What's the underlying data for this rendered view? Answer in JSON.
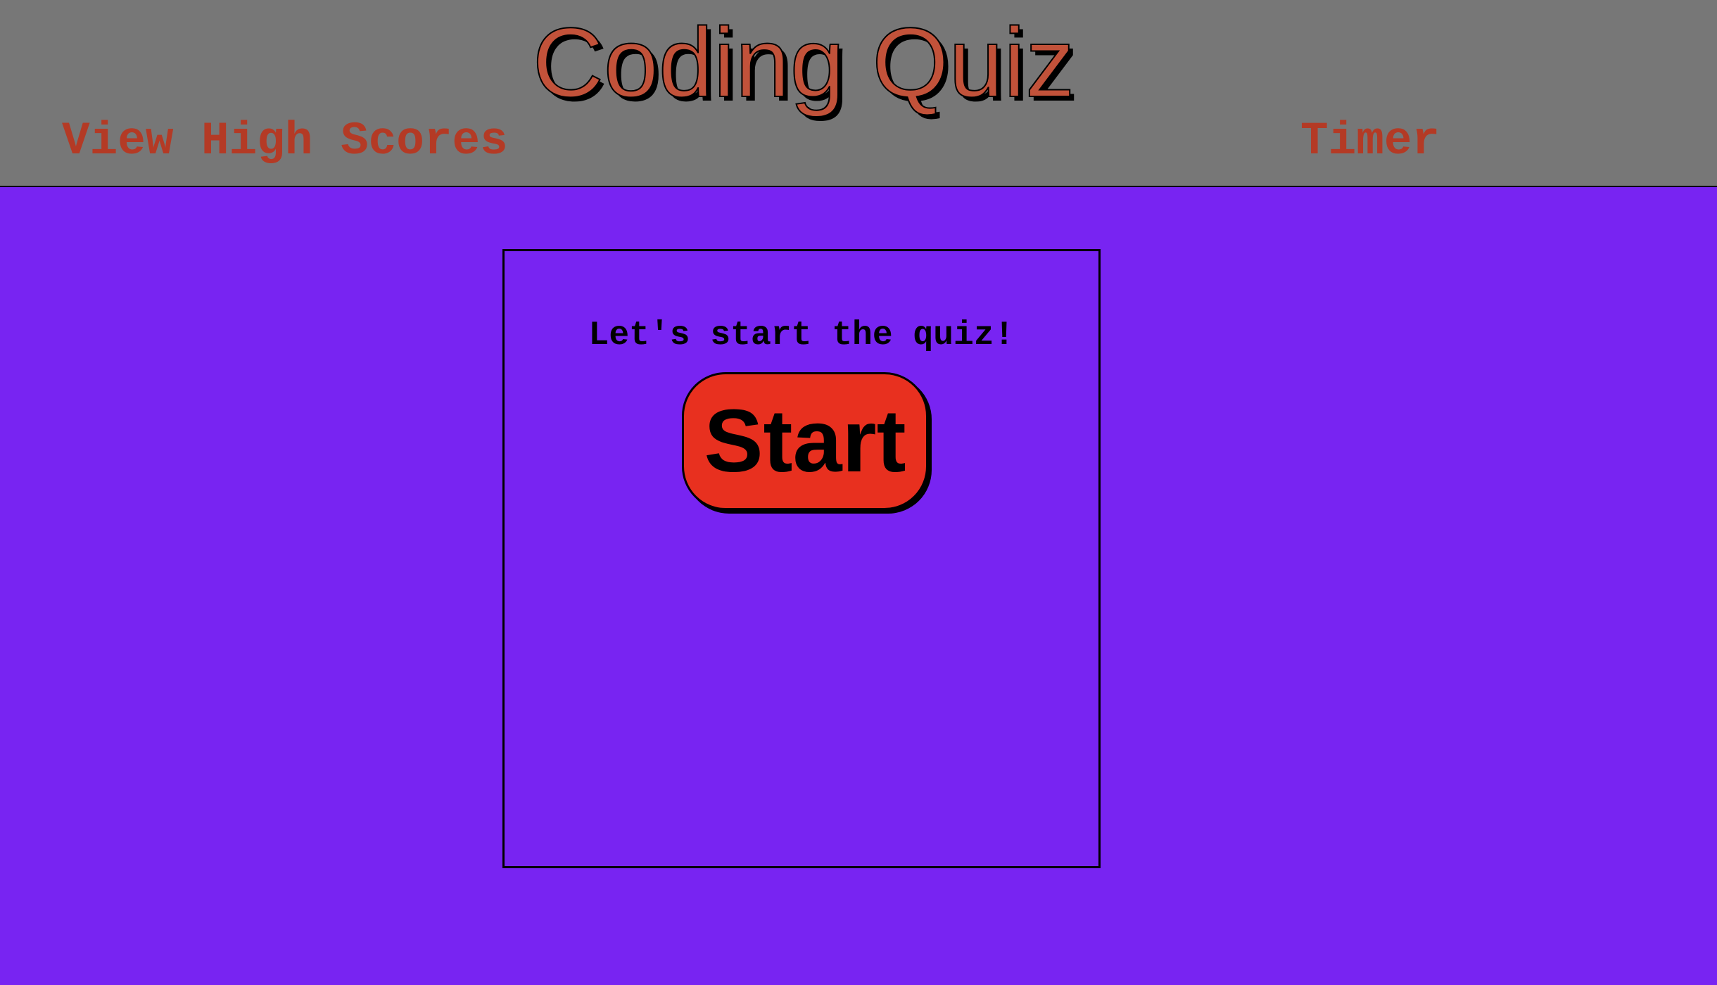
{
  "header": {
    "title": "Coding Quiz",
    "view_high_scores_label": "View High Scores",
    "timer_label": "Timer"
  },
  "main": {
    "prompt": "Let's start the quiz!",
    "start_button_label": "Start"
  },
  "colors": {
    "page_background": "#7824f2",
    "header_background": "#777777",
    "title_color": "#c2523a",
    "link_color": "#b43a25",
    "start_button_background": "#e8301f",
    "border": "#000000"
  }
}
